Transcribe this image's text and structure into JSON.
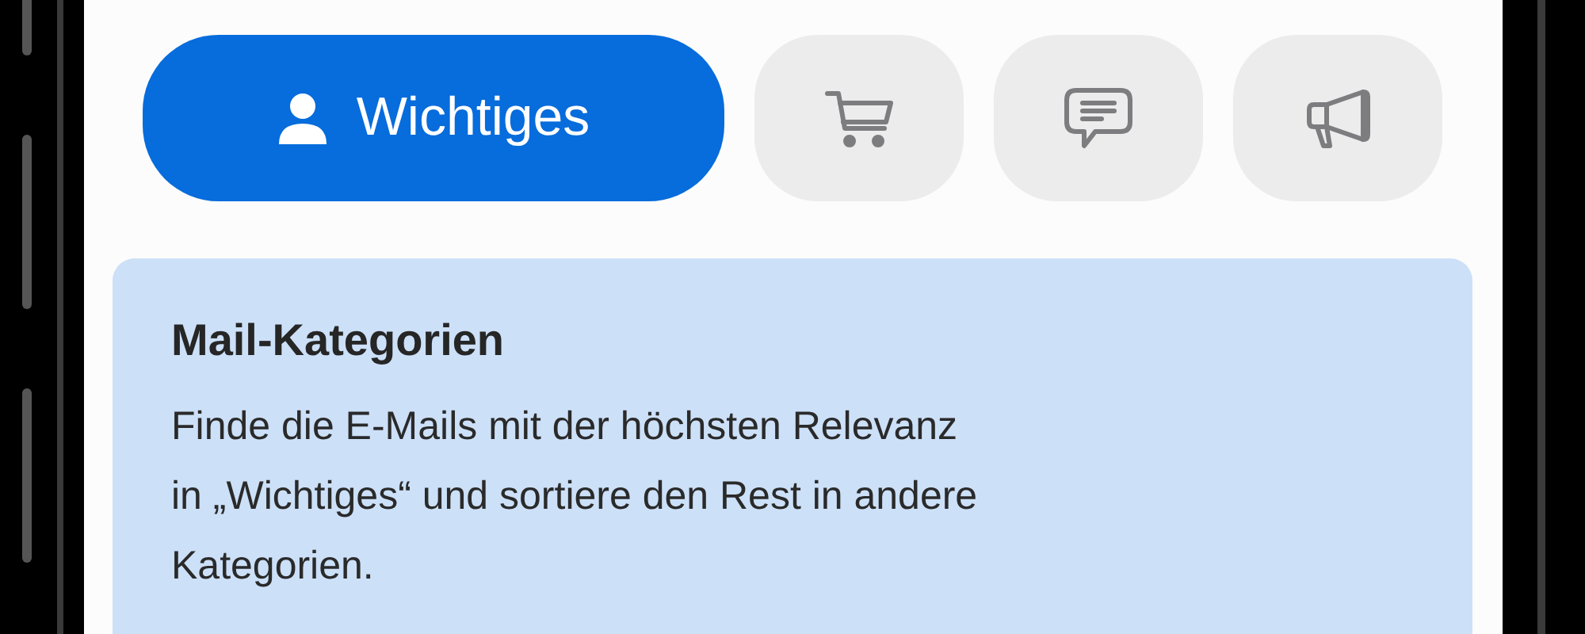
{
  "tabs": [
    {
      "label": "Wichtiges",
      "selected": true
    },
    {
      "selected": false
    },
    {
      "selected": false
    },
    {
      "selected": false
    }
  ],
  "card": {
    "title": "Mail-Kategorien",
    "body": "Finde die E-Mails mit der höchsten Relevanz\nin „Wichtiges“ und sortiere den Rest in andere\nKategorien."
  }
}
